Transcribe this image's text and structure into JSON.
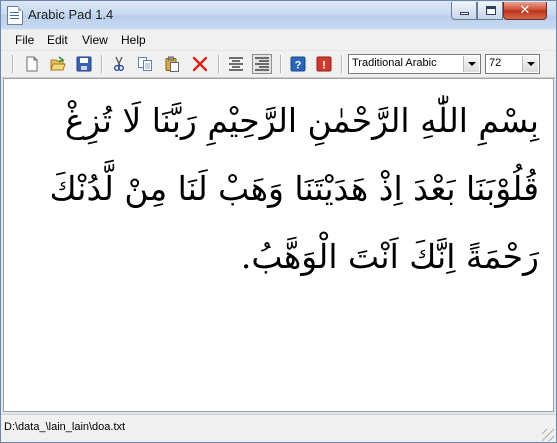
{
  "window": {
    "title": "Arabic Pad 1.4"
  },
  "window_controls": {
    "minimize": "minimize",
    "maximize": "maximize",
    "close": "close",
    "close_glyph": "✕"
  },
  "menu": {
    "items": [
      "File",
      "Edit",
      "View",
      "Help"
    ]
  },
  "toolbar": {
    "buttons": [
      "new-file-icon",
      "open-folder-icon",
      "save-icon",
      "cut-icon",
      "copy-icon",
      "paste-icon",
      "delete-icon",
      "align-center-icon",
      "align-right-icon",
      "help-icon",
      "about-icon"
    ],
    "pressed": "align-right-icon",
    "font_name": "Traditional Arabic",
    "font_size": "72"
  },
  "editor": {
    "text": "بِسْمِ اللّٰهِ الرَّحْمٰنِ الرَّحِيْمِ رَبَّنَا لَا تُزِغْ قُلُوْبَنَا بَعْدَ اِذْ هَدَيْتَنَا وَهَبْ لَنَا مِنْ لَّدُنْكَ رَحْمَةً اِنَّكَ اَنْتَ الْوَهَّبُ."
  },
  "status": {
    "path": "D:\\data_\\lain_lain\\doa.txt"
  },
  "colors": {
    "titlebar": "#c9dbf1",
    "close_button": "#c9452d",
    "chrome": "#f0f0f0",
    "accent_blue": "#2a66b8"
  }
}
